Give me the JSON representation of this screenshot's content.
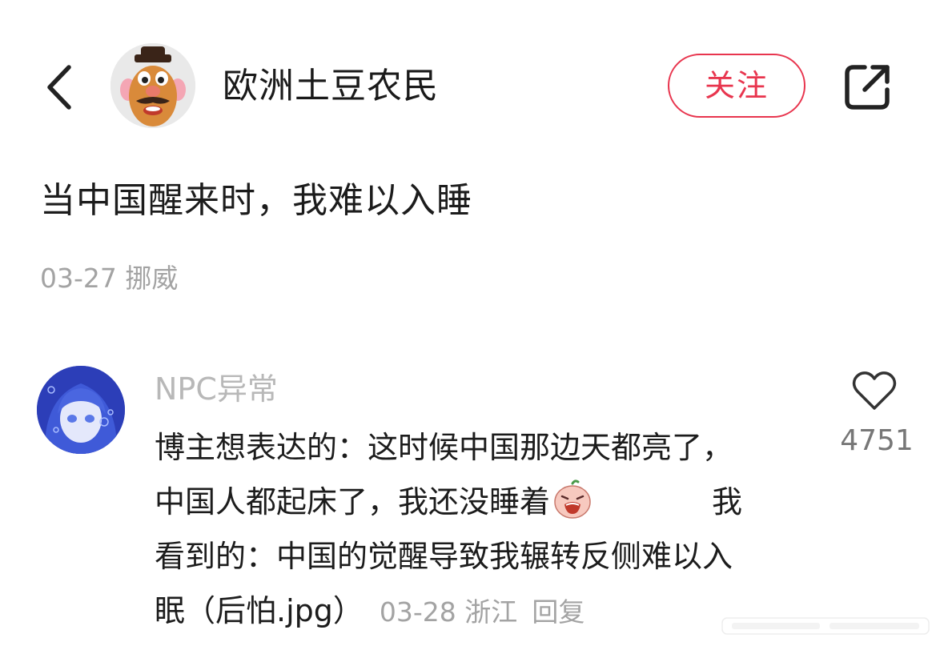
{
  "header": {
    "author_name": "欧洲土豆农民",
    "follow_label": "关注",
    "accent_color": "#e8354e",
    "back_icon": "chevron-left-icon",
    "share_icon": "share-icon"
  },
  "post": {
    "text": "当中国醒来时，我难以入睡",
    "meta": "03-27 挪威"
  },
  "comment": {
    "author": "NPC异常",
    "lines": [
      "博主想表达的：这时候中国那边天都亮了，",
      "中国人都起床了，我还没睡着",
      "我",
      "看到的：中国的觉醒导致我辗转反侧难以入",
      "眠（后怕.jpg）"
    ],
    "emoji_icon": "crying-face-icon",
    "meta": "03-28 浙江",
    "reply_label": "回复",
    "like_count": "4751",
    "like_icon": "heart-icon"
  }
}
